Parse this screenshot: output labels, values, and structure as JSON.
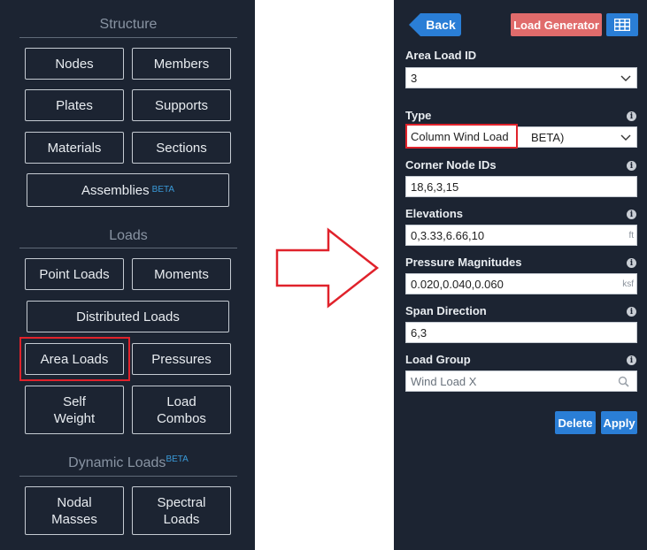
{
  "left": {
    "structure_title": "Structure",
    "loads_title": "Loads",
    "dynamic_title": "Dynamic Loads",
    "beta": "BETA",
    "buttons": {
      "nodes": "Nodes",
      "members": "Members",
      "plates": "Plates",
      "supports": "Supports",
      "materials": "Materials",
      "sections": "Sections",
      "assemblies": "Assemblies",
      "point_loads": "Point Loads",
      "moments": "Moments",
      "distributed_loads": "Distributed Loads",
      "area_loads": "Area Loads",
      "pressures": "Pressures",
      "self_weight_1": "Self",
      "self_weight_2": "Weight",
      "load_combos_1": "Load",
      "load_combos_2": "Combos",
      "nodal_masses_1": "Nodal",
      "nodal_masses_2": "Masses",
      "spectral_loads_1": "Spectral",
      "spectral_loads_2": "Loads"
    }
  },
  "right": {
    "back_label": "Back",
    "load_generator_label": "Load Generator",
    "area_load_id": {
      "label": "Area Load ID",
      "value": "3"
    },
    "type": {
      "label": "Type",
      "value": "Column Wind Load",
      "suffix": "BETA)"
    },
    "corner_nodes": {
      "label": "Corner Node IDs",
      "value": "18,6,3,15"
    },
    "elevations": {
      "label": "Elevations",
      "value": "0,3.33,6.66,10",
      "unit": "ft"
    },
    "pressures": {
      "label": "Pressure Magnitudes",
      "value": "0.020,0.040,0.060",
      "unit": "ksf"
    },
    "span_direction": {
      "label": "Span Direction",
      "value": "6,3"
    },
    "load_group": {
      "label": "Load Group",
      "placeholder": "Wind Load X"
    },
    "delete_label": "Delete",
    "apply_label": "Apply",
    "info_glyph": "i"
  },
  "colors": {
    "panel_bg": "#1c2432",
    "accent_blue": "#2a7ed6",
    "load_generator": "#e06b6b",
    "highlight_red": "#e0222b"
  }
}
